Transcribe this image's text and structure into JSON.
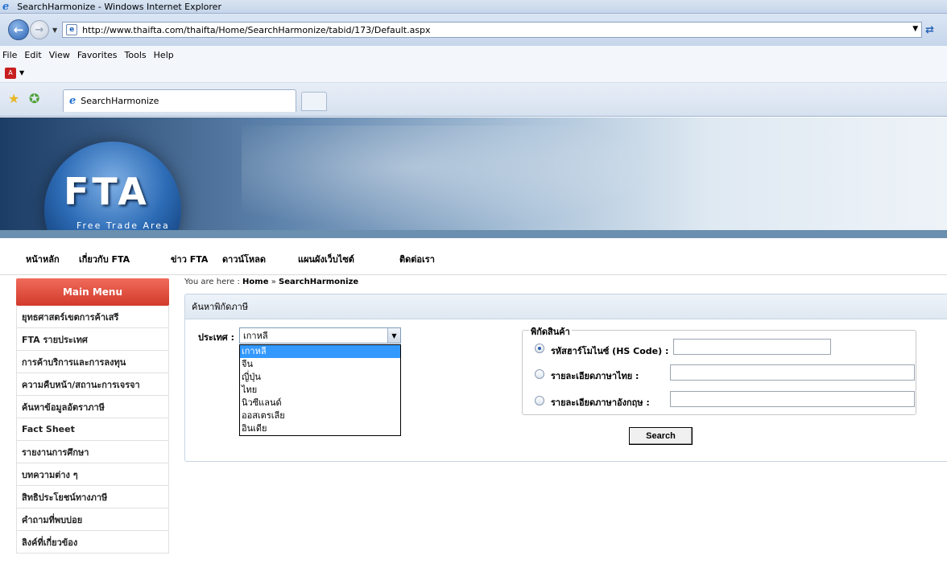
{
  "window": {
    "title": "SearchHarmonize - Windows Internet Explorer"
  },
  "address": {
    "url": "http://www.thaifta.com/thaifta/Home/SearchHarmonize/tabid/173/Default.aspx"
  },
  "menu": [
    "File",
    "Edit",
    "View",
    "Favorites",
    "Tools",
    "Help"
  ],
  "tab": {
    "label": "SearchHarmonize"
  },
  "banner": {
    "logo_text": "FTA",
    "logo_sub": "Free Trade Area"
  },
  "topnav": [
    "หน้าหลัก",
    "เกี่ยวกับ FTA",
    "ข่าว FTA",
    "ดาวน์โหลด",
    "แผนผังเว็บไซต์",
    "ติดต่อเรา"
  ],
  "sidebar": {
    "title": "Main Menu",
    "items": [
      "ยุทธศาสตร์เขตการค้าเสรี",
      "FTA รายประเทศ",
      "การค้าบริการและการลงทุน",
      "ความคืบหน้า/สถานะการเจรจา",
      "ค้นหาข้อมูลอัตราภาษี",
      "Fact Sheet",
      "รายงานการศึกษา",
      "บทความต่าง ๆ",
      "สิทธิประโยชน์ทางภาษี",
      "คำถามที่พบบ่อย",
      "ลิงค์ที่เกี่ยวข้อง"
    ]
  },
  "breadcrumb": {
    "prefix": "You are here :",
    "home": "Home",
    "sep": "»",
    "current": "SearchHarmonize"
  },
  "panel": {
    "title": "ค้นหาพิกัดภาษี"
  },
  "country": {
    "label": "ประเทศ :",
    "selected": "เกาหลี",
    "options": [
      "เกาหลี",
      "จีน",
      "ญี่ปุ่น",
      "ไทย",
      "นิวซีแลนด์",
      "ออสเตรเลีย",
      "อินเดีย"
    ]
  },
  "goods": {
    "legend": "พิกัดสินค้า",
    "options": [
      {
        "label": "รหัสฮาร์โมไนซ์ (HS Code) :",
        "checked": true,
        "value": ""
      },
      {
        "label": "รายละเอียดภาษาไทย :",
        "checked": false,
        "value": ""
      },
      {
        "label": "รายละเอียดภาษาอังกฤษ :",
        "checked": false,
        "value": ""
      }
    ]
  },
  "search_button": "Search"
}
